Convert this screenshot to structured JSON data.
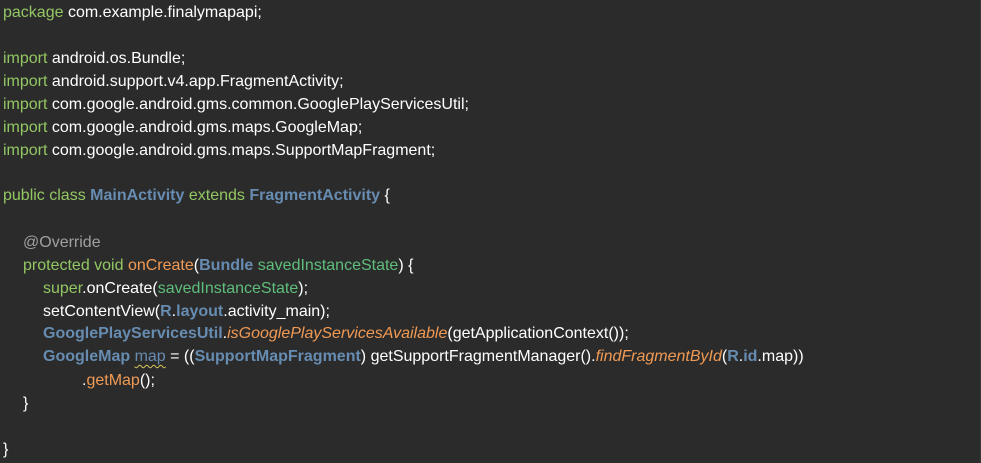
{
  "editor": {
    "package_kw": "package",
    "package_name": " com.example.finalymapapi;",
    "imports": [
      {
        "kw": "import",
        "path": " android.os.Bundle;"
      },
      {
        "kw": "import",
        "path": " android.support.v4.app.FragmentActivity;"
      },
      {
        "kw": "import",
        "path": " com.google.android.gms.common.GooglePlayServicesUtil;"
      },
      {
        "kw": "import",
        "path": " com.google.android.gms.maps.GoogleMap;"
      },
      {
        "kw": "import",
        "path": " com.google.android.gms.maps.SupportMapFragment;"
      }
    ],
    "class_decl": {
      "kw1": "public class ",
      "name": "MainActivity",
      "kw2": " extends ",
      "parent": "FragmentActivity",
      "brace": " {"
    },
    "annotation": "@Override",
    "method_decl": {
      "mods": "protected void ",
      "name": "onCreate",
      "open": "(",
      "type": "Bundle",
      "space": " ",
      "param": "savedInstanceState",
      "close": ") {"
    },
    "line_super": {
      "kw": "super",
      "call": ".onCreate(",
      "arg": "savedInstanceState",
      "end": ");"
    },
    "line_setcontent": {
      "call": "setContentView(",
      "r": "R",
      "dot1": ".",
      "layout": "layout",
      "rest": ".activity_main);"
    },
    "line_gps": {
      "cls": "GooglePlayServicesUtil",
      "dot": ".",
      "method": "isGooglePlayServicesAvailable",
      "rest": "(getApplicationContext());"
    },
    "line_map": {
      "type": "GoogleMap",
      "sp": " ",
      "var": "map",
      "eq": " = ((",
      "cast": "SupportMapFragment",
      "mid": ") getSupportFragmentManager().",
      "method": "findFragmentById",
      "open": "(",
      "r": "R",
      "dot": ".",
      "id": "id",
      "rest": ".map))"
    },
    "line_getmap": {
      "dot": ".",
      "method": "getMap",
      "rest": "();"
    },
    "method_close": "}",
    "class_close": "}"
  }
}
